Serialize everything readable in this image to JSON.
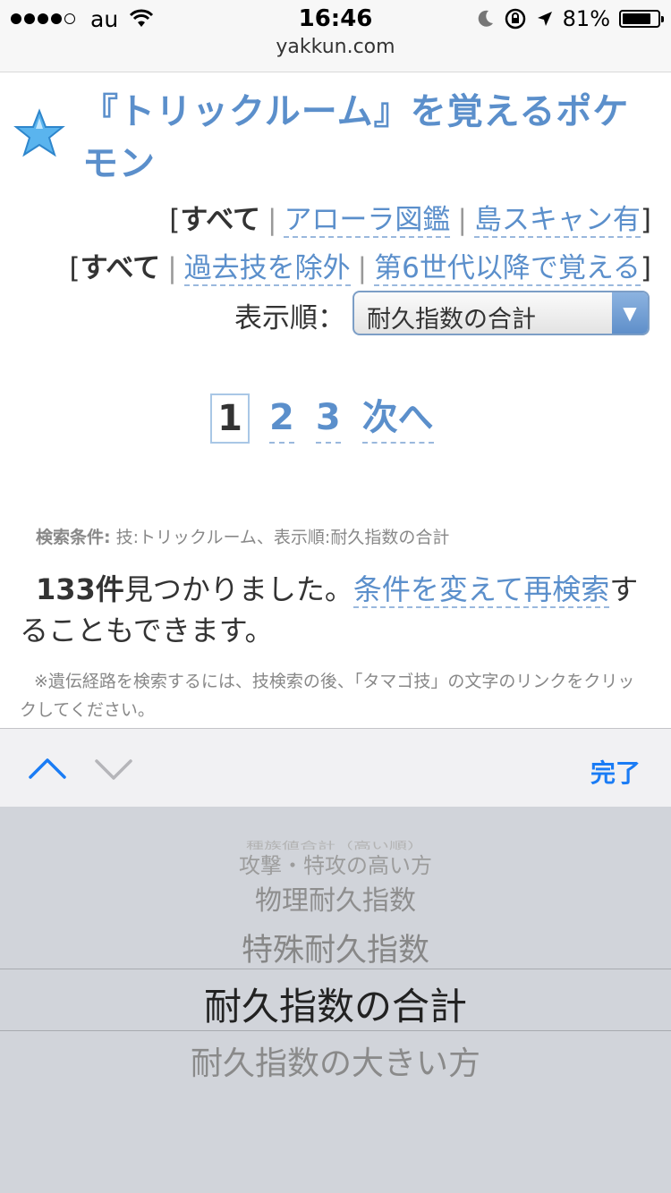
{
  "status_bar": {
    "carrier": "au",
    "time": "16:46",
    "battery_percent": "81%",
    "battery_level": 0.81,
    "signal_bars": 4
  },
  "browser": {
    "url": "yakkun.com"
  },
  "page": {
    "title": "『トリックルーム』を覚えるポケモン",
    "filter_region": {
      "current": "すべて",
      "links": [
        "アローラ図鑑",
        "島スキャン有"
      ]
    },
    "filter_generation": {
      "current": "すべて",
      "links": [
        "過去技を除外",
        "第6世代以降で覚える"
      ]
    },
    "sort": {
      "label": "表示順：",
      "selected": "耐久指数の合計"
    },
    "pagination": {
      "current": "1",
      "pages": [
        "2",
        "3"
      ],
      "next": "次へ"
    },
    "search_condition": {
      "label": "検索条件:",
      "value": "技:トリックルーム、表示順:耐久指数の合計"
    },
    "result": {
      "count": "133件",
      "text_found": "見つかりました。",
      "link": "条件を変えて再検索",
      "text_after": "することもできます。"
    },
    "note": "※遺伝経路を検索するには、技検索の後、「タマゴ技」の文字のリンクをクリックしてください。"
  },
  "accessory_bar": {
    "done_label": "完了"
  },
  "picker": {
    "items": [
      "種族値合計（高い順）",
      "攻撃・特攻の高い方",
      "物理耐久指数",
      "特殊耐久指数",
      "耐久指数の合計",
      "耐久指数の大きい方"
    ],
    "selected_index": 4
  },
  "colors": {
    "link": "#5b8fcb",
    "ios_blue": "#1a7cf5",
    "picker_bg": "#d1d4da"
  }
}
